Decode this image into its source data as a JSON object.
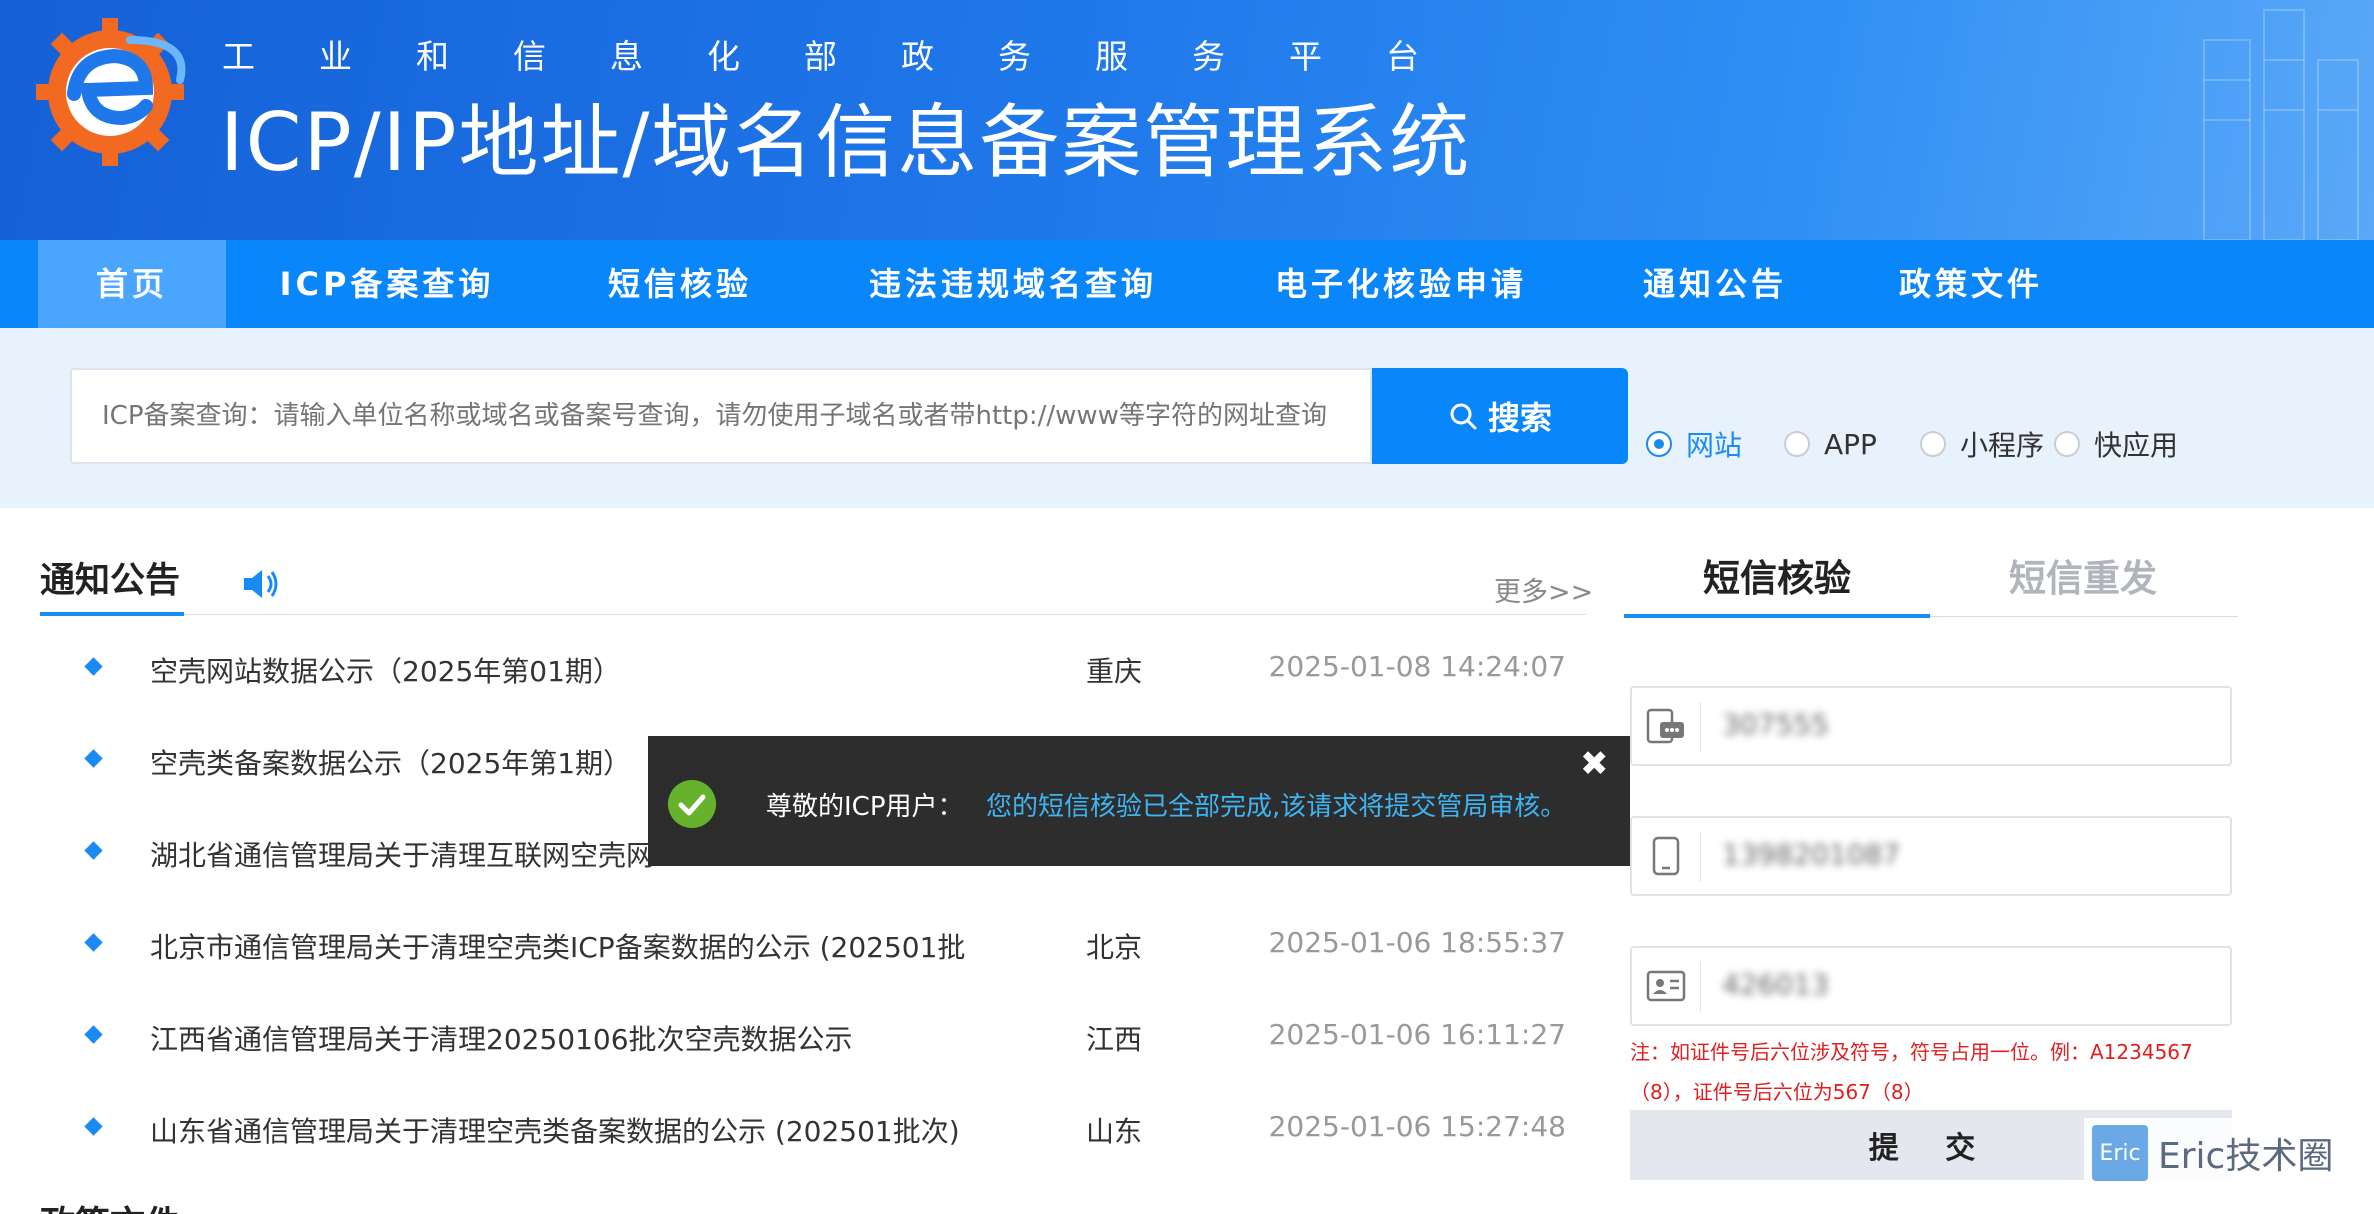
{
  "header": {
    "subtitle": "工业和信息化部政务服务平台",
    "title": "ICP/IP地址/域名信息备案管理系统"
  },
  "nav": [
    {
      "label": "首页",
      "active": true
    },
    {
      "label": "ICP备案查询",
      "active": false
    },
    {
      "label": "短信核验",
      "active": false
    },
    {
      "label": "违法违规域名查询",
      "active": false
    },
    {
      "label": "电子化核验申请",
      "active": false
    },
    {
      "label": "通知公告",
      "active": false
    },
    {
      "label": "政策文件",
      "active": false
    }
  ],
  "search": {
    "placeholder": "ICP备案查询：请输入单位名称或域名或备案号查询，请勿使用子域名或者带http://www等字符的网址查询",
    "button_label": "搜索",
    "types": [
      {
        "label": "网站",
        "checked": true
      },
      {
        "label": "APP",
        "checked": false
      },
      {
        "label": "小程序",
        "checked": false
      },
      {
        "label": "快应用",
        "checked": false
      }
    ]
  },
  "notices": {
    "title": "通知公告",
    "more_label": "更多>>",
    "items": [
      {
        "title": "空壳网站数据公示（2025年第01期）",
        "region": "重庆",
        "time": "2025-01-08 14:24:07"
      },
      {
        "title": "空壳类备案数据公示（2025年第1期）",
        "region": "",
        "time": ""
      },
      {
        "title": "湖北省通信管理局关于清理互联网空壳网",
        "region": "",
        "time": ""
      },
      {
        "title": "北京市通信管理局关于清理空壳类ICP备案数据的公示 (202501批",
        "region": "北京",
        "time": "2025-01-06 18:55:37"
      },
      {
        "title": "江西省通信管理局关于清理20250106批次空壳数据公示",
        "region": "江西",
        "time": "2025-01-06 16:11:27"
      },
      {
        "title": "山东省通信管理局关于清理空壳类备案数据的公示 (202501批次)",
        "region": "山东",
        "time": "2025-01-06 15:27:48"
      }
    ]
  },
  "policy": {
    "title": "政策文件"
  },
  "sms": {
    "tab_active": "短信核验",
    "tab_inactive": "短信重发",
    "fields": [
      {
        "icon": "sms-code-icon",
        "value": "307555"
      },
      {
        "icon": "phone-icon",
        "value": "1398201087"
      },
      {
        "icon": "id-card-icon",
        "value": "426013"
      }
    ],
    "note": "注：如证件号后六位涉及符号，符号占用一位。例：A1234567（8），证件号后六位为567（8）",
    "submit_label": "提 交"
  },
  "toast": {
    "prefix": "尊敬的ICP用户：",
    "message": "您的短信核验已全部完成,该请求将提交管局审核。",
    "close_label": "✖"
  },
  "watermark": {
    "logo_text": "Eric",
    "text": "Eric技术圈"
  },
  "colors": {
    "primary": "#0a86fb",
    "nav_active": "#4aa6fc",
    "success": "#66b22c",
    "toast_message": "#3eb4f3",
    "note": "#e02020"
  }
}
